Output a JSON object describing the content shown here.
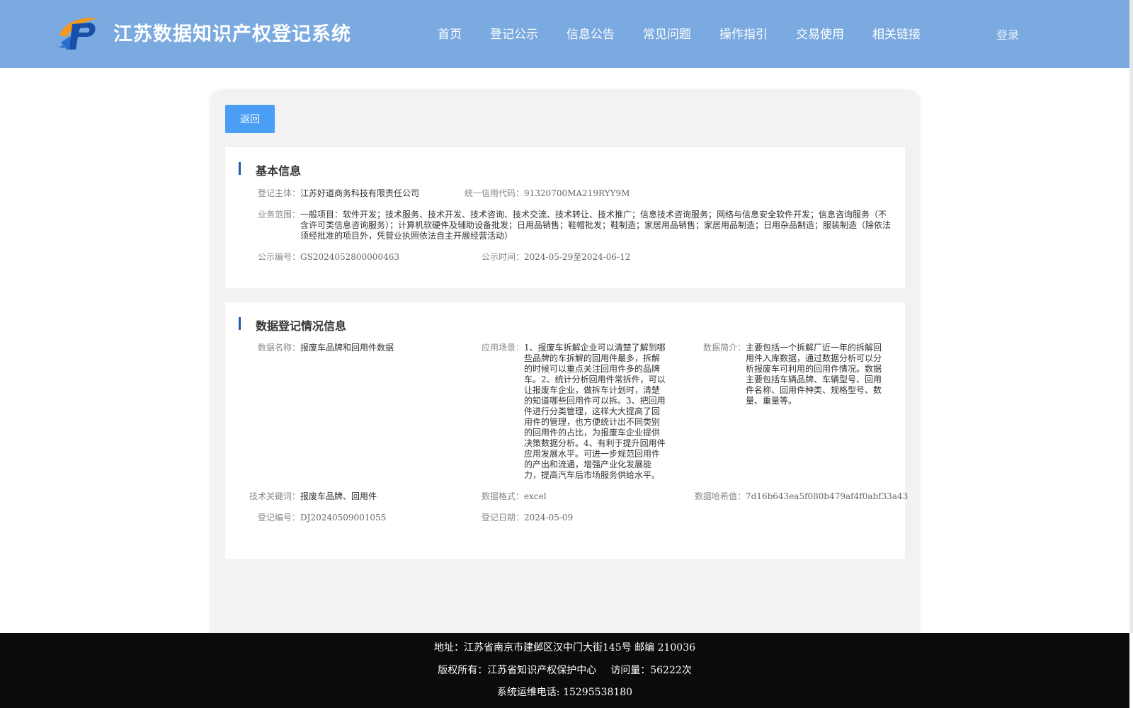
{
  "header": {
    "title": "江苏数据知识产权登记系统",
    "logo_icon": "p-logo-icon",
    "nav": [
      "首页",
      "登记公示",
      "信息公告",
      "常见问题",
      "操作指引",
      "交易使用",
      "相关链接"
    ],
    "login": "登录"
  },
  "back_label": "返回",
  "basic": {
    "title": "基本信息",
    "subject_label": "登记主体：",
    "subject": "江苏好道商务科技有限责任公司",
    "credit_label": "统一信用代码：",
    "credit": "91320700MA219RYY9M",
    "scope_label": "业务范围：",
    "scope": "一般项目：软件开发；技术服务、技术开发、技术咨询、技术交流、技术转让、技术推广；信息技术咨询服务；网络与信息安全软件开发；信息咨询服务（不含许可类信息咨询服务）；计算机软硬件及辅助设备批发；日用品销售；鞋帽批发；鞋制造；家居用品销售；家居用品制造；日用杂品制造；服装制造（除依法须经批准的项目外，凭营业执照依法自主开展经营活动）",
    "pub_no_label": "公示编号：",
    "pub_no": "GS2024052800000463",
    "pub_time_label": "公示时间：",
    "pub_time": "2024-05-29至2024-06-12"
  },
  "registration": {
    "title": "数据登记情况信息",
    "name_label": "数据名称：",
    "name": "报废车品牌和回用件数据",
    "scene_label": "应用场景：",
    "scene": "1、报废车拆解企业可以清楚了解到哪些品牌的车拆解的回用件最多，拆解的时候可以重点关注回用件多的品牌车。2、统计分析回用件常拆件，可以让报废车企业，做拆车计划时，清楚的知道哪些回用件可以拆。3、把回用件进行分类管理，这样大大提高了回用件的管理，也方便统计出不同类别的回用件的占比，为报废车企业提供决策数据分析。4、有利于提升回用件应用发展水平。可进一步规范回用件的产出和流通，增强产业化发展能力，提高汽车后市场服务供给水平。",
    "intro_label": "数据简介：",
    "intro": "主要包括一个拆解厂近一年的拆解回用件入库数据，通过数据分析可以分析报废车可利用的回用件情况。数据主要包括车辆品牌、车辆型号、回用件名称、回用件种类、规格型号、数量、重量等。",
    "keywords_label": "技术关键词：",
    "keywords": "报废车品牌、回用件",
    "format_label": "数据格式：",
    "format": "excel",
    "hash_label": "数据哈希值：",
    "hash": "7d16b643ea5f080b479af4f0abf33a43",
    "reg_no_label": "登记编号：",
    "reg_no": "DJ20240509001055",
    "reg_date_label": "登记日期：",
    "reg_date": "2024-05-09"
  },
  "footer": {
    "address": "地址：江苏省南京市建邺区汉中门大街145号 邮编 210036",
    "copyright": "版权所有：江苏省知识产权保护中心",
    "visits": "访问量：56222次",
    "phone": "系统运维电话: 15295538180"
  }
}
